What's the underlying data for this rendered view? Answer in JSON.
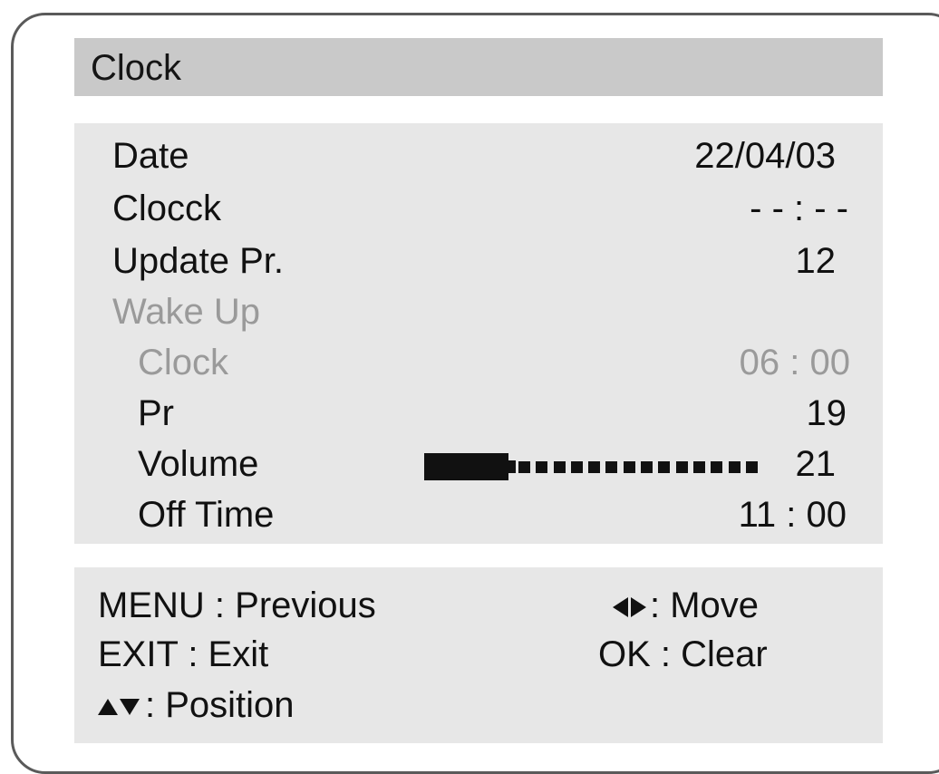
{
  "menu": {
    "title": "Clock"
  },
  "settings": {
    "date": {
      "label": "Date",
      "value": "22/04/03"
    },
    "clock": {
      "label": "Clocck",
      "value": "- - : - -"
    },
    "update_pr": {
      "label": "Update Pr.",
      "value": "12"
    },
    "wake_up": {
      "label": "Wake Up",
      "clock": {
        "label": "Clock",
        "value": "06 : 00"
      },
      "pr": {
        "label": "Pr",
        "value": "19"
      },
      "volume": {
        "label": "Volume",
        "value": "21",
        "level_fraction": 0.25
      },
      "off_time": {
        "label": "Off Time",
        "value": "11 : 00"
      }
    }
  },
  "help": {
    "menu": ": Previous",
    "menu_key": "MENU",
    "exit_key": "EXIT",
    "exit": ": Exit",
    "position": ": Position",
    "move": ": Move",
    "ok_key": "OK",
    "ok": ": Clear"
  },
  "colors": {
    "title_bar": "#c9c9c9",
    "panel": "#e7e7e7",
    "text": "#111111",
    "disabled_text": "#9a9a9a",
    "border": "#5a5a5a"
  },
  "icons": {
    "move": "left-right-arrows-icon",
    "position": "up-down-arrows-icon"
  }
}
